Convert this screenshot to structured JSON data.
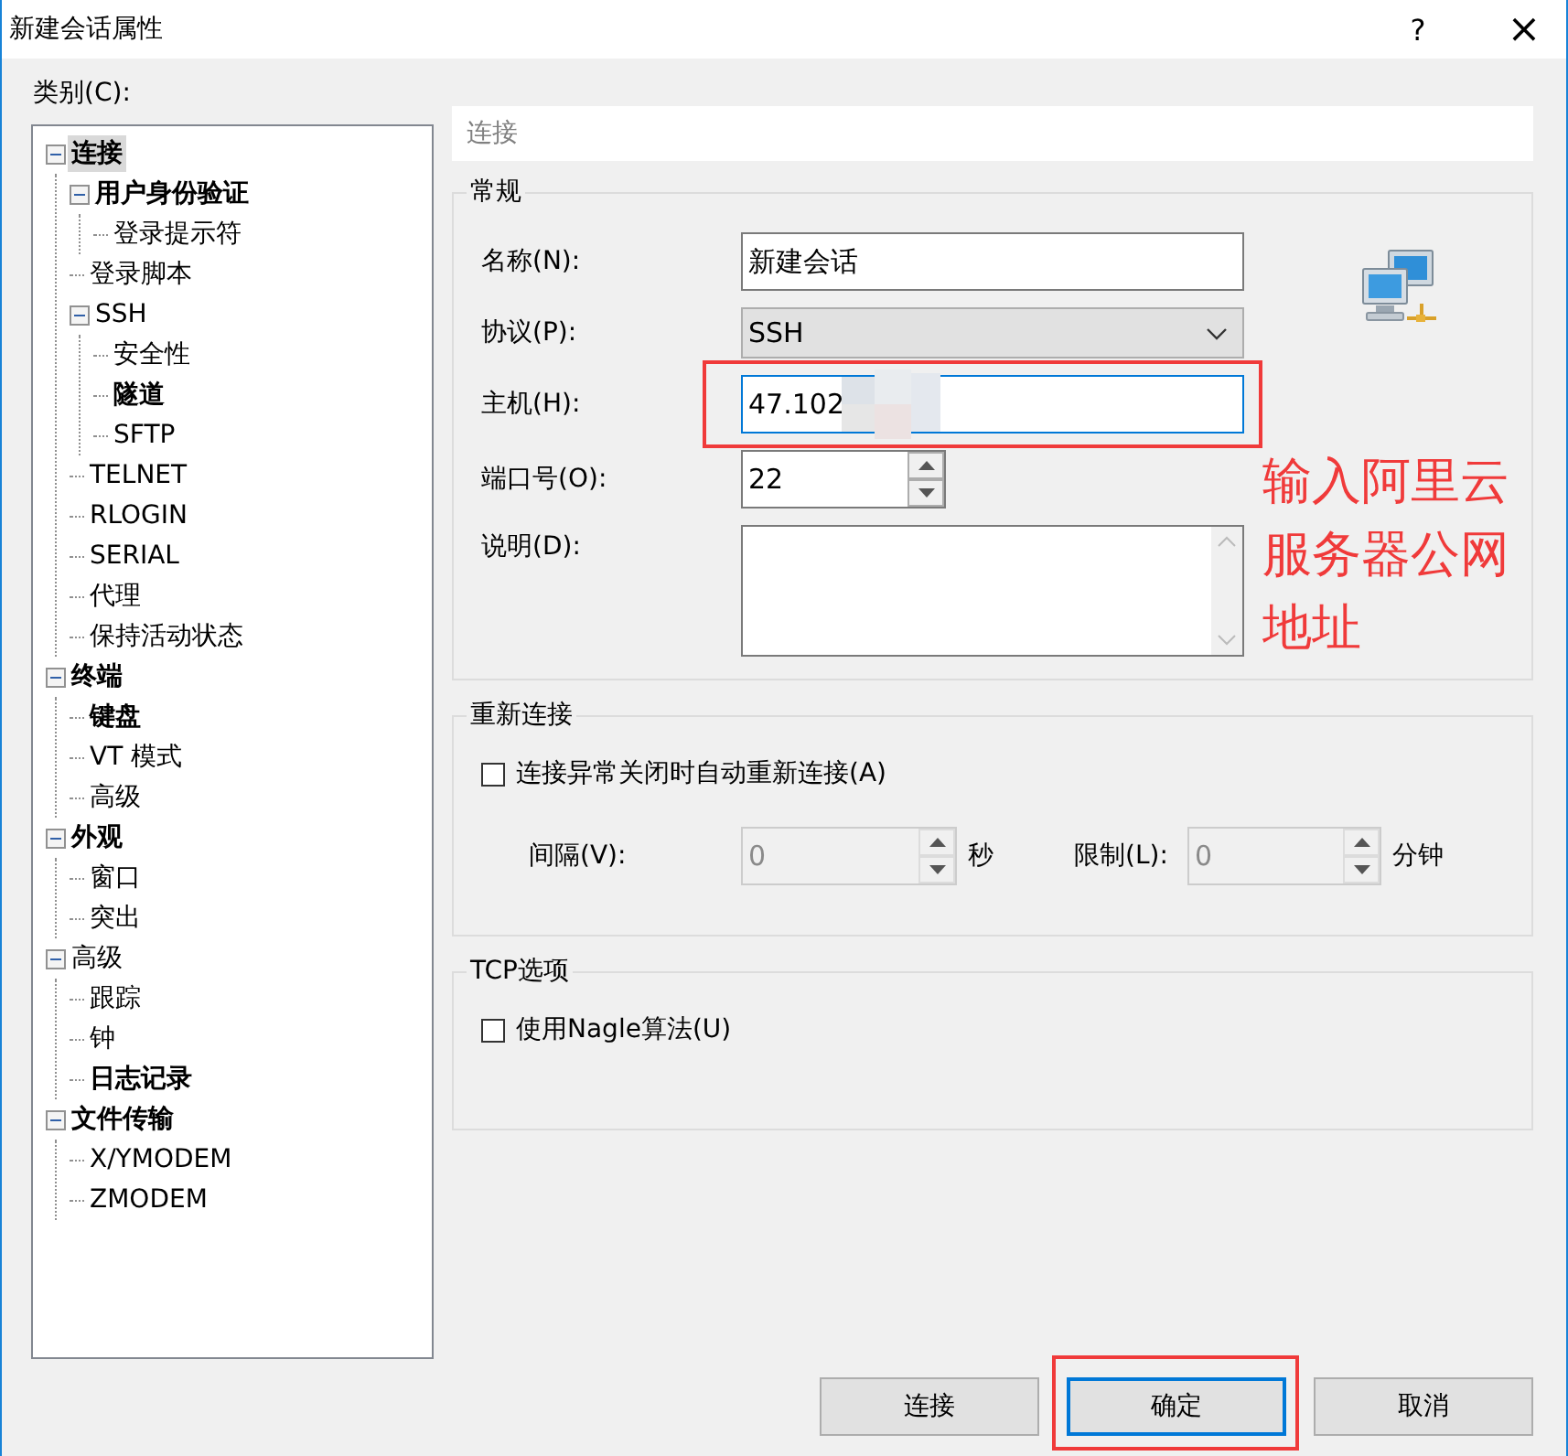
{
  "window": {
    "title": "新建会话属性",
    "help": "?",
    "close": "×"
  },
  "category_label": "类别(C):",
  "tree": [
    {
      "label": "连接",
      "bold": true,
      "selected": true,
      "expanded": true,
      "children": [
        {
          "label": "用户身份验证",
          "bold": true,
          "selected": false,
          "expanded": true,
          "children": [
            {
              "label": "登录提示符",
              "bold": false,
              "selected": false
            }
          ]
        },
        {
          "label": "登录脚本",
          "bold": false,
          "selected": false
        },
        {
          "label": "SSH",
          "bold": false,
          "selected": false,
          "expanded": true,
          "children": [
            {
              "label": "安全性",
              "bold": false,
              "selected": false
            },
            {
              "label": "隧道",
              "bold": true,
              "selected": false
            },
            {
              "label": "SFTP",
              "bold": false,
              "selected": false
            }
          ]
        },
        {
          "label": "TELNET",
          "bold": false,
          "selected": false
        },
        {
          "label": "RLOGIN",
          "bold": false,
          "selected": false
        },
        {
          "label": "SERIAL",
          "bold": false,
          "selected": false
        },
        {
          "label": "代理",
          "bold": false,
          "selected": false
        },
        {
          "label": "保持活动状态",
          "bold": false,
          "selected": false
        }
      ]
    },
    {
      "label": "终端",
      "bold": true,
      "selected": false,
      "expanded": true,
      "children": [
        {
          "label": "键盘",
          "bold": true,
          "selected": false
        },
        {
          "label": "VT 模式",
          "bold": false,
          "selected": false
        },
        {
          "label": "高级",
          "bold": false,
          "selected": false
        }
      ]
    },
    {
      "label": "外观",
      "bold": true,
      "selected": false,
      "expanded": true,
      "children": [
        {
          "label": "窗口",
          "bold": false,
          "selected": false
        },
        {
          "label": "突出",
          "bold": false,
          "selected": false
        }
      ]
    },
    {
      "label": "高级",
      "bold": false,
      "selected": false,
      "expanded": true,
      "children": [
        {
          "label": "跟踪",
          "bold": false,
          "selected": false
        },
        {
          "label": "钟",
          "bold": false,
          "selected": false
        },
        {
          "label": "日志记录",
          "bold": true,
          "selected": false
        }
      ]
    },
    {
      "label": "文件传输",
      "bold": true,
      "selected": false,
      "expanded": true,
      "children": [
        {
          "label": "X/YMODEM",
          "bold": false,
          "selected": false
        },
        {
          "label": "ZMODEM",
          "bold": false,
          "selected": false
        }
      ]
    }
  ],
  "panel_title": "连接",
  "general": {
    "title": "常规",
    "fields": [
      {
        "label": "名称(N):",
        "kind": "text",
        "value": "新建会话",
        "focused": false
      },
      {
        "label": "协议(P):",
        "kind": "select",
        "value": "SSH"
      },
      {
        "label": "主机(H):",
        "kind": "text",
        "value": "47.102",
        "focused": true,
        "highlighted": true,
        "redacted": true
      },
      {
        "label": "端口号(O):",
        "kind": "spin",
        "value": "22"
      },
      {
        "label": "说明(D):",
        "kind": "textarea"
      }
    ]
  },
  "annotation": "输入阿里云服务器公网地址",
  "reconnect": {
    "title": "重新连接",
    "checkbox": {
      "label": "连接异常关闭时自动重新连接(A)",
      "checked": false
    },
    "spins": [
      {
        "label": "间隔(V):",
        "value": "0",
        "unit": "秒",
        "disabled": true
      },
      {
        "label": "限制(L):",
        "value": "0",
        "unit": "分钟",
        "disabled": true
      }
    ]
  },
  "tcp": {
    "title": "TCP选项",
    "checkbox": {
      "label": "使用Nagle算法(U)",
      "checked": false
    }
  },
  "buttons": [
    {
      "label": "连接",
      "focused": false
    },
    {
      "label": "确定",
      "focused": true,
      "highlighted": true
    },
    {
      "label": "取消",
      "focused": false
    }
  ]
}
